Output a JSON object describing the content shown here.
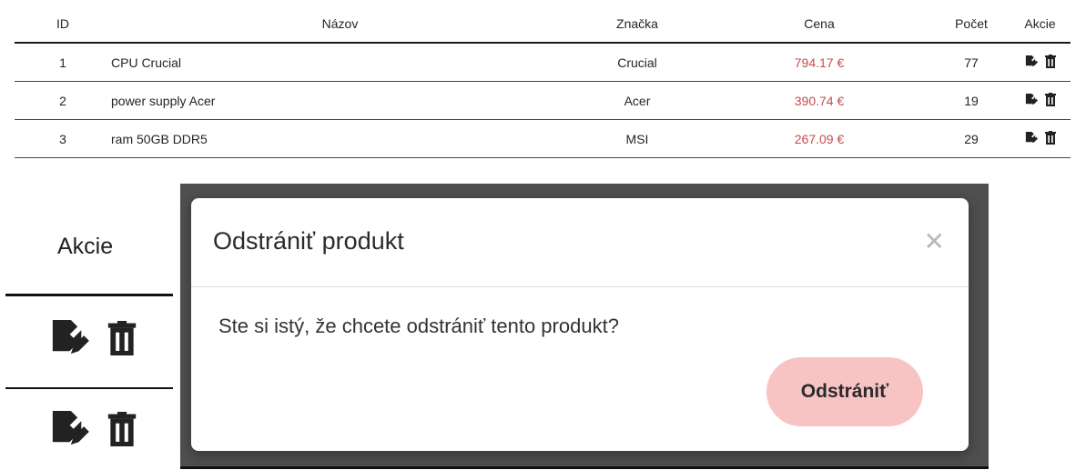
{
  "table": {
    "headers": {
      "id": "ID",
      "name": "Názov",
      "brand": "Značka",
      "price": "Cena",
      "count": "Počet",
      "actions": "Akcie"
    },
    "rows": [
      {
        "id": "1",
        "name": "CPU Crucial",
        "brand": "Crucial",
        "price": "794.17 €",
        "count": "77"
      },
      {
        "id": "2",
        "name": "power supply Acer",
        "brand": "Acer",
        "price": "390.74 €",
        "count": "19"
      },
      {
        "id": "3",
        "name": "ram 50GB DDR5",
        "brand": "MSI",
        "price": "267.09 €",
        "count": "29"
      }
    ],
    "row_actions": [
      "edit-icon",
      "trash-icon"
    ]
  },
  "zoom": {
    "header": "Akcie",
    "icons": [
      "edit-icon",
      "trash-icon"
    ]
  },
  "modal": {
    "title": "Odstrániť produkt",
    "close_icon": "close-icon",
    "message": "Ste si istý, že chcete odstrániť tento produkt?",
    "confirm_label": "Odstrániť"
  },
  "colors": {
    "price": "#c94b4b",
    "confirm_button": "#f8c3c3",
    "backdrop": "#4f4f4f"
  }
}
